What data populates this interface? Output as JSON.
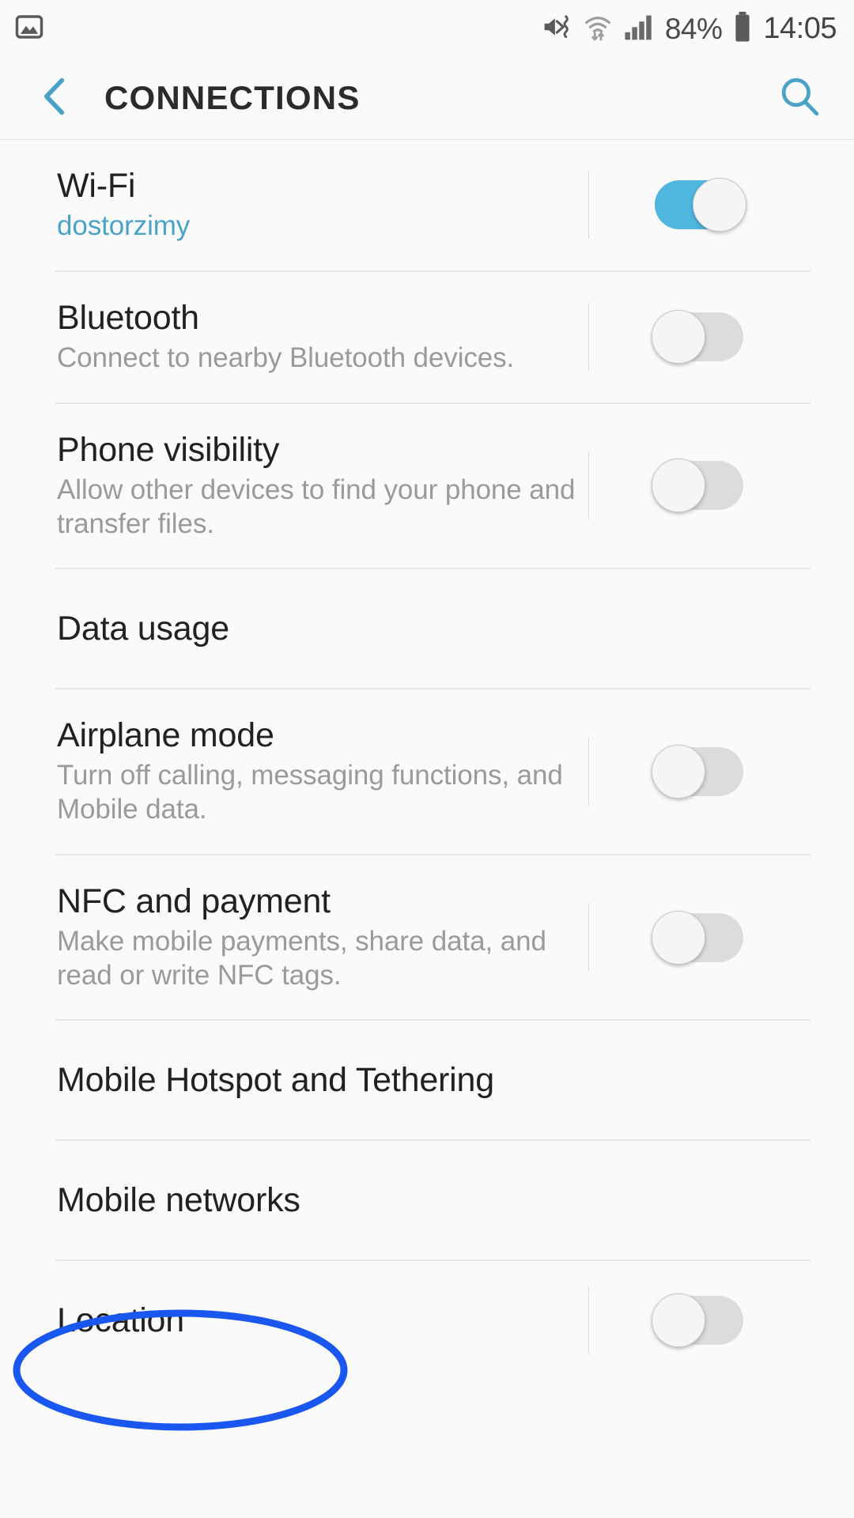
{
  "status_bar": {
    "left_icons": [
      {
        "name": "image-notification-icon",
        "label": "screenshot"
      }
    ],
    "right_icons": [
      {
        "name": "mute-vibrate-icon",
        "label": "sound off"
      },
      {
        "name": "wifi-transfer-icon",
        "label": "wi-fi"
      },
      {
        "name": "cellular-signal-icon",
        "label": "signal"
      }
    ],
    "battery_percent": "84%",
    "battery_icon": "battery-icon",
    "clock": "14:05"
  },
  "app_bar": {
    "back_icon": "back-chevron-icon",
    "title": "CONNECTIONS",
    "search_icon": "search-icon"
  },
  "colors": {
    "accent": "#4aa3c7",
    "toggle_on": "#4fb6e0",
    "toggle_off": "#dcdcdc",
    "annotation": "#1a56f0",
    "background": "#fafafa",
    "title_text": "#212121",
    "subtitle_text": "#9a9a9a"
  },
  "settings": {
    "rows": [
      {
        "id": "wifi",
        "title": "Wi-Fi",
        "subtitle": "dostorzimy",
        "subtitle_accent": true,
        "control": "toggle",
        "toggle_on": true,
        "tall": false
      },
      {
        "id": "bluetooth",
        "title": "Bluetooth",
        "subtitle": "Connect to nearby Bluetooth devices.",
        "subtitle_accent": false,
        "control": "toggle",
        "toggle_on": false,
        "tall": false
      },
      {
        "id": "phone-visibility",
        "title": "Phone visibility",
        "subtitle": "Allow other devices to find your phone and transfer files.",
        "subtitle_accent": false,
        "control": "toggle",
        "toggle_on": false,
        "tall": true
      },
      {
        "id": "data-usage",
        "title": "Data usage",
        "subtitle": "",
        "subtitle_accent": false,
        "control": "none",
        "toggle_on": false,
        "tall": false
      },
      {
        "id": "airplane-mode",
        "title": "Airplane mode",
        "subtitle": "Turn off calling, messaging functions, and Mobile data.",
        "subtitle_accent": false,
        "control": "toggle",
        "toggle_on": false,
        "tall": true
      },
      {
        "id": "nfc-and-payment",
        "title": "NFC and payment",
        "subtitle": "Make mobile payments, share data, and read or write NFC tags.",
        "subtitle_accent": false,
        "control": "toggle",
        "toggle_on": false,
        "tall": true
      },
      {
        "id": "mobile-hotspot-and-tethering",
        "title": "Mobile Hotspot and Tethering",
        "subtitle": "",
        "subtitle_accent": false,
        "control": "none",
        "toggle_on": false,
        "tall": false
      },
      {
        "id": "mobile-networks",
        "title": "Mobile networks",
        "subtitle": "",
        "subtitle_accent": false,
        "control": "none",
        "toggle_on": false,
        "tall": false,
        "highlighted": true
      },
      {
        "id": "location",
        "title": "Location",
        "subtitle": "",
        "subtitle_accent": false,
        "control": "toggle",
        "toggle_on": false,
        "tall": false
      }
    ]
  },
  "annotation": {
    "type": "ellipse",
    "target": "Mobile networks",
    "color": "#1a56f0"
  }
}
